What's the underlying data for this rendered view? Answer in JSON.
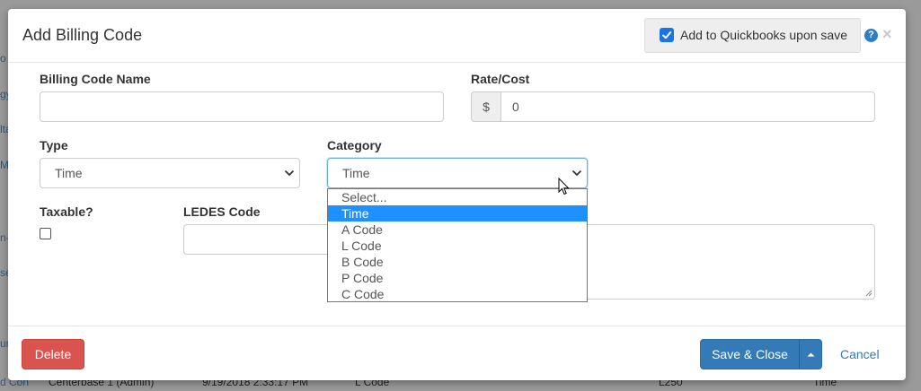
{
  "background": {
    "edge_snippets": [
      "o",
      "gy",
      "lta",
      "M",
      "n-",
      "se",
      "un",
      "d Con"
    ],
    "row": {
      "user": "Centerbase 1 (Admin)",
      "timestamp": "9/19/2018 2:33:17 PM",
      "category": "L Code",
      "code": "L250",
      "type": "Time"
    }
  },
  "modal": {
    "title": "Add Billing Code",
    "quickbooks": {
      "label": "Add to Quickbooks upon save",
      "checked": true
    },
    "help_icon": "question-circle-icon",
    "close_icon": "close-icon"
  },
  "form": {
    "billing_code_name": {
      "label": "Billing Code Name",
      "value": ""
    },
    "rate_cost": {
      "label": "Rate/Cost",
      "currency_symbol": "$",
      "value": "0"
    },
    "type": {
      "label": "Type",
      "value": "Time"
    },
    "category": {
      "label": "Category",
      "value": "Time",
      "options": [
        "Select...",
        "Time",
        "A Code",
        "L Code",
        "B Code",
        "P Code",
        "C Code"
      ],
      "highlighted": "Time"
    },
    "taxable": {
      "label": "Taxable?",
      "checked": false
    },
    "ledes_code": {
      "label": "LEDES Code",
      "value": ""
    }
  },
  "footer": {
    "delete_label": "Delete",
    "save_label": "Save & Close",
    "cancel_label": "Cancel"
  },
  "colors": {
    "primary": "#337ab7",
    "danger": "#d9534f",
    "highlight": "#1e90ff",
    "checkbox_accent": "#1a73e8"
  }
}
